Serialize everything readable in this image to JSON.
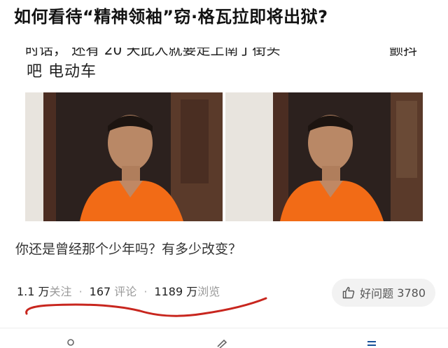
{
  "title": "如何看待“精神领袖”窃·格瓦拉即将出狱?",
  "media": {
    "caption_line1": "时话，  还有 20 天此人就要走上南丁街头",
    "caption_line1_right": "颤抖",
    "caption_line2": "吧 电动车"
  },
  "question_text": "你还是曾经那个少年吗？有多少改变？",
  "stats": {
    "follow_count": "1.1 万",
    "follow_label": "关注",
    "comment_count": "167",
    "comment_label": "评论",
    "view_count": "1189 万",
    "view_label": "浏览",
    "separator": "·"
  },
  "helpful_button": {
    "label": "好问题",
    "count": "3780",
    "icon": "thumbs-up-icon"
  },
  "colors": {
    "annotation_red": "#c8261e",
    "vest_orange": "#f26b16",
    "button_bg": "#f2f2f2"
  }
}
